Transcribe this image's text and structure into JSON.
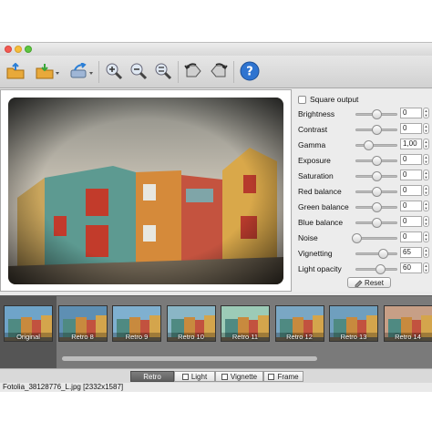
{
  "window": {
    "traffic_lights": [
      "close",
      "minimize",
      "zoom"
    ]
  },
  "toolbar": {
    "buttons": [
      {
        "icon": "open-folder-icon"
      },
      {
        "icon": "save-folder-icon"
      },
      {
        "icon": "share-icon"
      },
      {
        "icon": "zoom-in-icon"
      },
      {
        "icon": "zoom-out-icon"
      },
      {
        "icon": "zoom-fit-icon"
      },
      {
        "icon": "rotate-left-icon"
      },
      {
        "icon": "rotate-right-icon"
      },
      {
        "icon": "help-icon"
      }
    ]
  },
  "panel": {
    "square_output_label": "Square output",
    "square_output_checked": false,
    "adjustments": [
      {
        "label": "Brightness",
        "value": "0",
        "level": 0.5
      },
      {
        "label": "Contrast",
        "value": "0",
        "level": 0.5
      },
      {
        "label": "Gamma",
        "value": "1,00",
        "level": 0.3
      },
      {
        "label": "Exposure",
        "value": "0",
        "level": 0.5
      },
      {
        "label": "Saturation",
        "value": "0",
        "level": 0.5
      },
      {
        "label": "Red balance",
        "value": "0",
        "level": 0.5
      },
      {
        "label": "Green balance",
        "value": "0",
        "level": 0.5
      },
      {
        "label": "Blue balance",
        "value": "0",
        "level": 0.5
      },
      {
        "label": "Noise",
        "value": "0",
        "level": 0.0
      },
      {
        "label": "Vignetting",
        "value": "65",
        "level": 0.65
      },
      {
        "label": "Light opacity",
        "value": "60",
        "level": 0.6
      }
    ],
    "reset_label": "Reset"
  },
  "presets": [
    {
      "label": "Original",
      "tint": "#6fa4c9",
      "selected": true
    },
    {
      "label": "Retro 8",
      "tint": "#5e8fb3"
    },
    {
      "label": "Retro 9",
      "tint": "#7fb0d0"
    },
    {
      "label": "Retro 10",
      "tint": "#8ab6c6"
    },
    {
      "label": "Retro 11",
      "tint": "#9ccbb7"
    },
    {
      "label": "Retro 12",
      "tint": "#7aa7c4"
    },
    {
      "label": "Retro 13",
      "tint": "#6f9fbe"
    },
    {
      "label": "Retro 14",
      "tint": "#c79f86"
    }
  ],
  "tabs": [
    {
      "label": "Retro",
      "active": true
    },
    {
      "label": "Light"
    },
    {
      "label": "Vignette"
    },
    {
      "label": "Frame"
    }
  ],
  "status": {
    "filename": "Fotolia_38128776_L.jpg [2332x1587]"
  }
}
